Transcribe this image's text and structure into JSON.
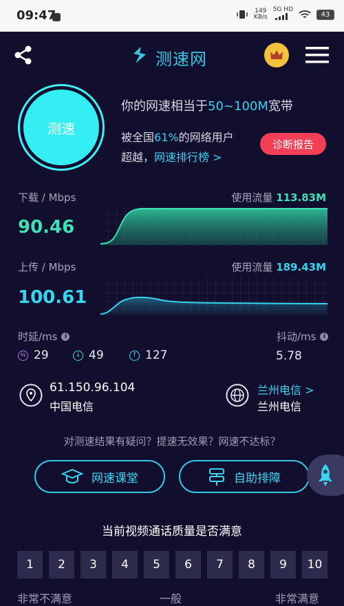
{
  "status_bar": {
    "time": "09:47",
    "net_speed_value": "149",
    "net_speed_unit": "KB/s",
    "network_type": "5G HD",
    "battery": "43"
  },
  "header": {
    "title": "测速网"
  },
  "test_button": {
    "label": "测速"
  },
  "summary": {
    "speed_prefix": "你的网速相当于",
    "speed_value": "50~100M",
    "speed_suffix": "宽带",
    "beat_prefix": "被全国",
    "beat_percent": "61%",
    "beat_suffix": "的网络用户",
    "exceed_text": "超越，",
    "ranking_link": "网速排行榜 >",
    "diagnosis_button": "诊断报告"
  },
  "download": {
    "label": "下载 / Mbps",
    "value": "90.46",
    "usage_label": "使用流量",
    "usage_value": "113.83M"
  },
  "upload": {
    "label": "上传 / Mbps",
    "value": "100.61",
    "usage_label": "使用流量",
    "usage_value": "189.43M"
  },
  "latency": {
    "label": "时延/ms",
    "ping": "29",
    "down": "49",
    "up": "127",
    "jitter_label": "抖动/ms",
    "jitter": "5.78"
  },
  "network": {
    "ip": "61.150.96.104",
    "isp": "中国电信",
    "server_link": "兰州电信 >",
    "server": "兰州电信"
  },
  "help": {
    "question": "对测速结果有疑问？提速无效果？网速不达标？",
    "classroom_button": "网速课堂",
    "troubleshoot_button": "自助排障"
  },
  "rating": {
    "title": "当前视频通话质量是否满意",
    "options": [
      "1",
      "2",
      "3",
      "4",
      "5",
      "6",
      "7",
      "8",
      "9",
      "10"
    ],
    "low_label": "非常不满意",
    "mid_label": "一般",
    "high_label": "非常满意"
  },
  "colors": {
    "background": "#110f2d",
    "accent_cyan": "#36d6f0",
    "accent_green": "#3fe0b5",
    "danger": "#f23f55",
    "gold": "#f5c23e"
  }
}
